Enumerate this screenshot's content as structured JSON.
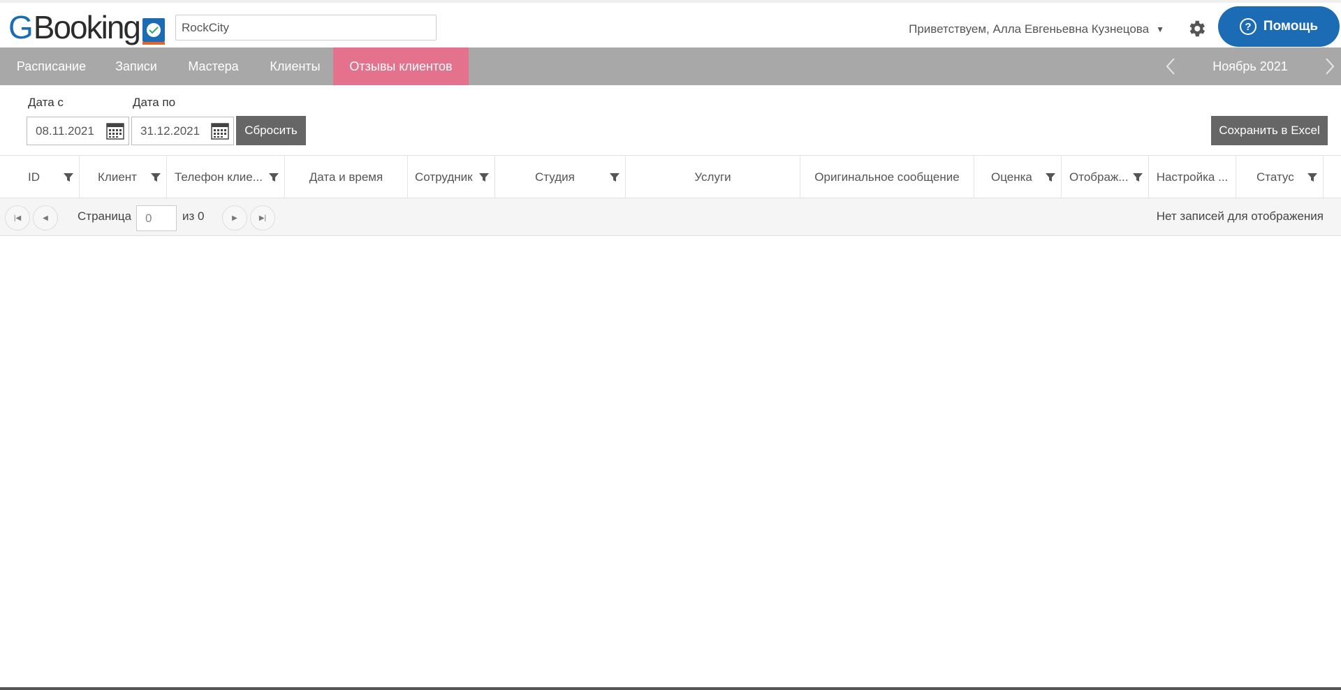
{
  "header": {
    "logo_g": "G",
    "logo_rest": "Booking",
    "search_value": "RockCity",
    "greeting": "Приветствуем, Алла Евгеньевна Кузнецова",
    "help_label": "Помощь"
  },
  "nav": {
    "items": [
      {
        "label": "Расписание"
      },
      {
        "label": "Записи"
      },
      {
        "label": "Мастера"
      },
      {
        "label": "Клиенты"
      },
      {
        "label": "Отзывы клиентов"
      }
    ],
    "month": "Ноябрь 2021"
  },
  "filters": {
    "date_from_label": "Дата с",
    "date_from_value": "08.11.2021",
    "date_to_label": "Дата по",
    "date_to_value": "31.12.2021",
    "reset_label": "Сбросить",
    "export_label": "Сохранить в Excel"
  },
  "table": {
    "columns": [
      {
        "label": "ID"
      },
      {
        "label": "Клиент"
      },
      {
        "label": "Телефон клие..."
      },
      {
        "label": "Дата и время"
      },
      {
        "label": "Сотрудник"
      },
      {
        "label": "Студия"
      },
      {
        "label": "Услуги"
      },
      {
        "label": "Оригинальное сообщение"
      },
      {
        "label": "Оценка"
      },
      {
        "label": "Отображ..."
      },
      {
        "label": "Настройка ..."
      },
      {
        "label": "Статус"
      }
    ]
  },
  "pager": {
    "page_label": "Страница",
    "page_value": "0",
    "of_label": "из 0",
    "empty_text": "Нет записей для отображения"
  },
  "colors": {
    "brand_blue": "#1b6bb5",
    "nav_bg": "#a8a8a8",
    "nav_active": "#e4728d",
    "button_dark": "#666666"
  }
}
